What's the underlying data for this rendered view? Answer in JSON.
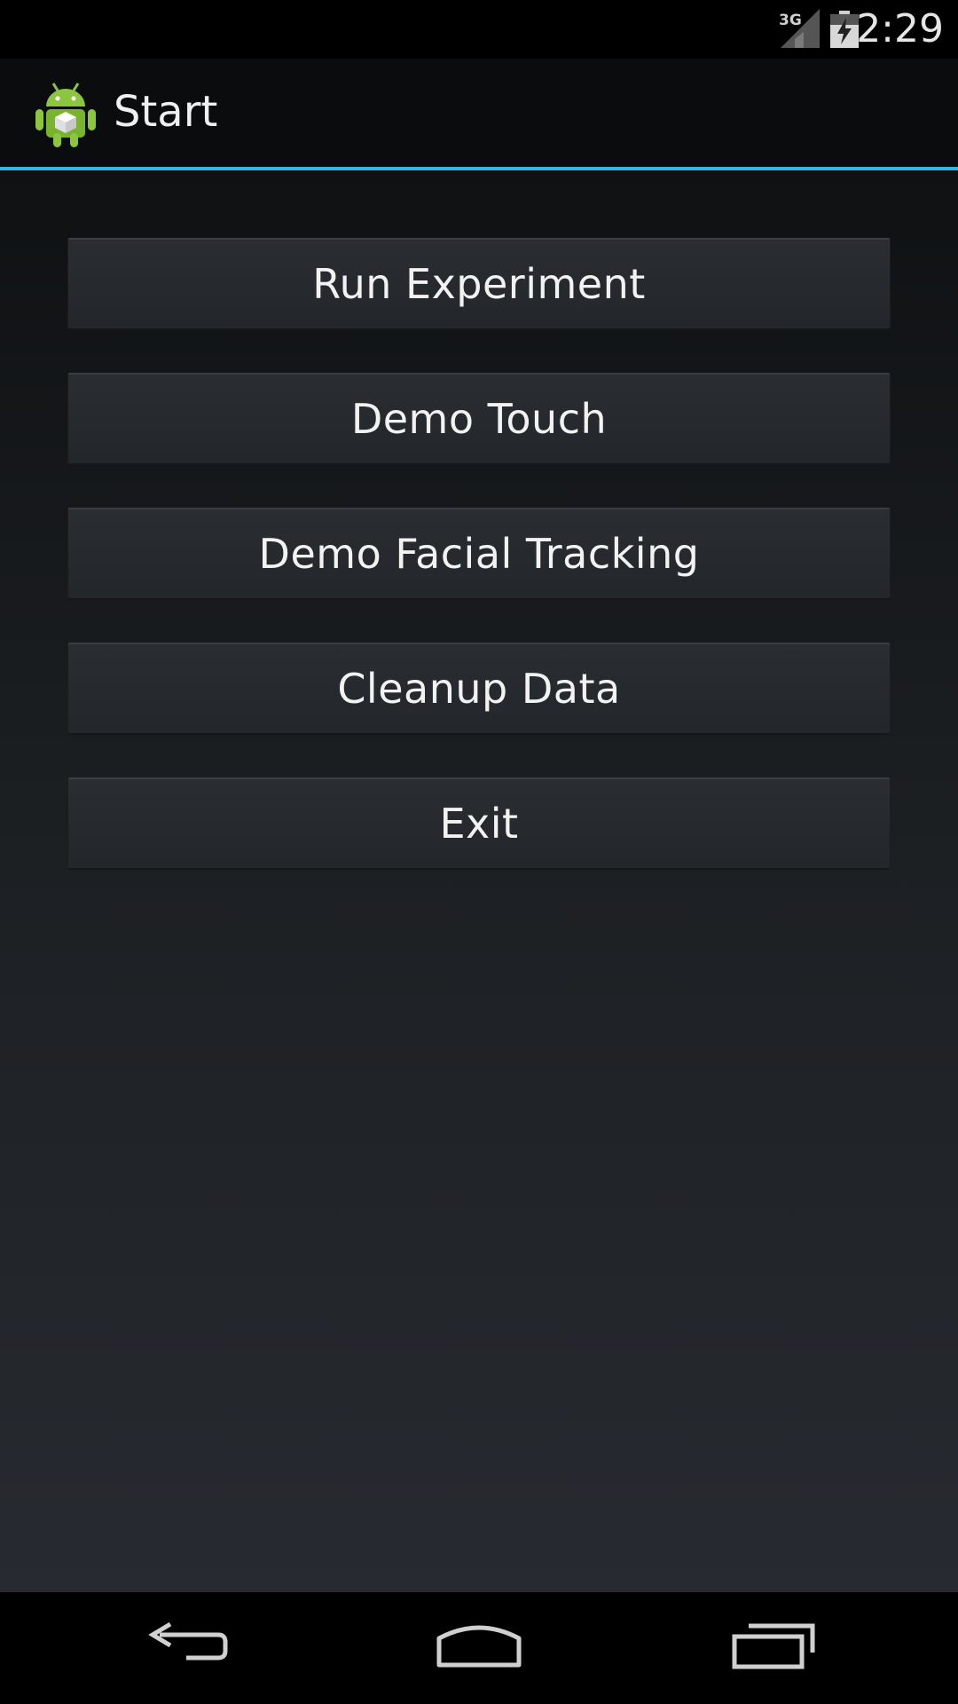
{
  "status_bar": {
    "time": "2:29",
    "network": "3G",
    "icons": [
      "signal-icon",
      "battery-charging-icon"
    ]
  },
  "action_bar": {
    "title": "Start",
    "app_icon": "android-app-icon"
  },
  "buttons": [
    {
      "label": "Run Experiment"
    },
    {
      "label": "Demo Touch"
    },
    {
      "label": "Demo Facial Tracking"
    },
    {
      "label": "Cleanup Data"
    },
    {
      "label": "Exit"
    }
  ],
  "nav_bar": {
    "icons": [
      "back-icon",
      "home-icon",
      "recent-apps-icon"
    ]
  },
  "colors": {
    "accent": "#33b5e5",
    "background": "#1c1f22",
    "button": "#26292d"
  }
}
